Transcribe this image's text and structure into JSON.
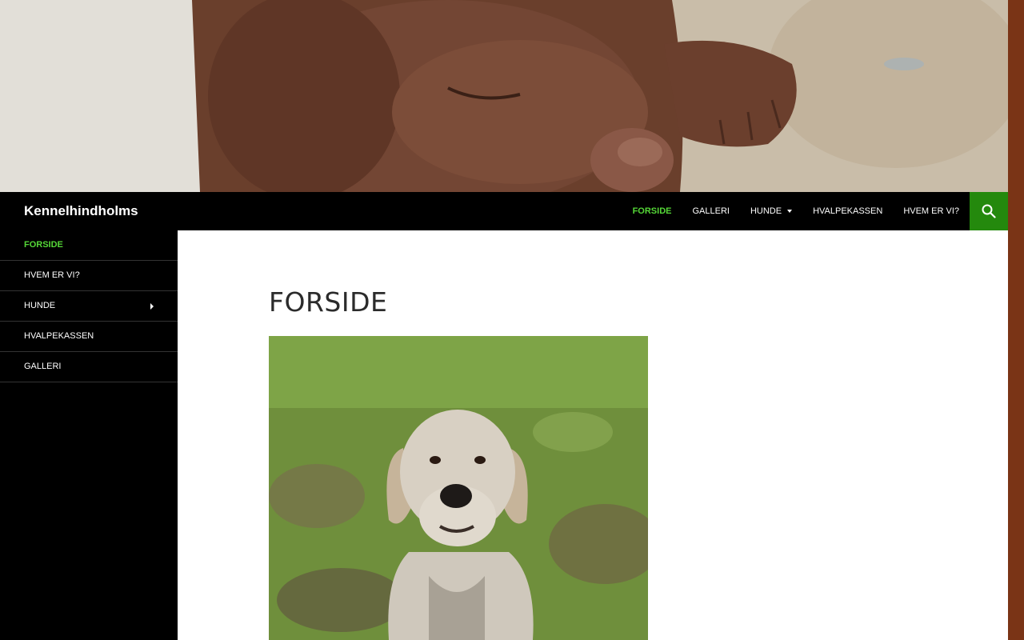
{
  "site": {
    "title": "Kennelhindholms"
  },
  "top_nav": {
    "items": [
      {
        "label": "FORSIDE",
        "active": true
      },
      {
        "label": "GALLERI"
      },
      {
        "label": "HUNDE",
        "has_submenu": true
      },
      {
        "label": "HVALPEKASSEN"
      },
      {
        "label": "HVEM ER VI?"
      }
    ],
    "search_icon": "search-icon"
  },
  "sidebar": {
    "items": [
      {
        "label": "FORSIDE",
        "active": true
      },
      {
        "label": "HVEM ER VI?"
      },
      {
        "label": "HUNDE",
        "has_submenu": true
      },
      {
        "label": "HVALPEKASSEN"
      },
      {
        "label": "GALLERI"
      }
    ]
  },
  "page": {
    "title": "FORSIDE"
  },
  "colors": {
    "accent": "#55d737",
    "search_bg": "#24890d",
    "bar_bg": "#000000",
    "side_strip": "#7a3416"
  }
}
